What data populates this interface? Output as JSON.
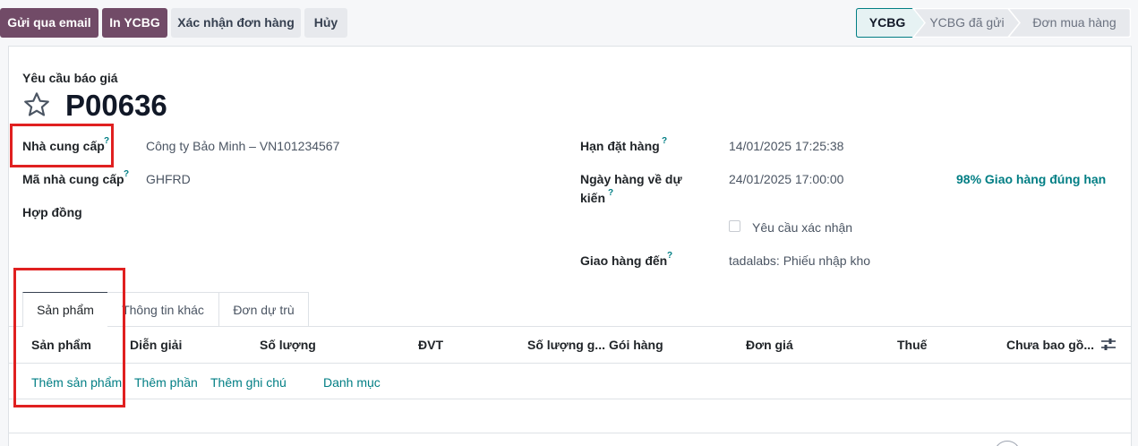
{
  "actions": {
    "send_email": "Gửi qua email",
    "print_rfq": "In YCBG",
    "confirm_order": "Xác nhận đơn hàng",
    "cancel": "Hủy"
  },
  "statusbar": {
    "stages": [
      "YCBG",
      "YCBG đã gửi",
      "Đơn mua hàng"
    ],
    "active_index": 0
  },
  "form": {
    "subtitle": "Yêu cầu báo giá",
    "reference": "P00636",
    "help_mark": "?",
    "fields_left": [
      {
        "label": "Nhà cung cấp",
        "value": "Công ty Bảo Minh – VN101234567",
        "help": true
      },
      {
        "label": "Mã nhà cung cấp",
        "value": "GHFRD",
        "help": true
      },
      {
        "label": "Hợp đồng",
        "value": "",
        "help": false
      }
    ],
    "fields_right": {
      "order_deadline": {
        "label": "Hạn đặt hàng",
        "value": "14/01/2025 17:25:38"
      },
      "expected_arrival": {
        "label_line1": "Ngày hàng về dự",
        "label_line2": "kiến",
        "value": "24/01/2025 17:00:00",
        "badge": "98% Giao hàng đúng hạn"
      },
      "ask_confirmation": {
        "label": "Yêu cầu xác nhận",
        "checked": false
      },
      "deliver_to": {
        "label": "Giao hàng đến",
        "value": "tadalabs: Phiếu nhập kho"
      }
    }
  },
  "tabs": [
    "Sản phẩm",
    "Thông tin khác",
    "Đơn dự trù"
  ],
  "order_lines": {
    "headers": [
      "Sản phẩm",
      "Diễn giải",
      "Số lượng",
      "ĐVT",
      "Số lượng g...",
      "Gói hàng",
      "Đơn giá",
      "Thuế",
      "Chưa bao gồ..."
    ],
    "add_links": [
      "Thêm sản phẩm",
      "Thêm phần",
      "Thêm ghi chú",
      "Danh mục"
    ]
  },
  "colors": {
    "primary": "#714b67",
    "link": "#017e84",
    "highlight": "#e02020"
  },
  "icons": [
    "star-icon",
    "optional-columns-icon",
    "checkbox-icon"
  ]
}
